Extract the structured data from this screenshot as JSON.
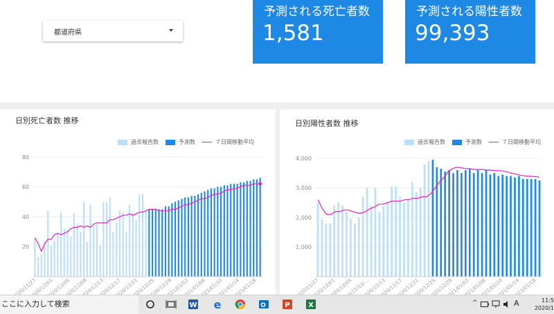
{
  "filter": {
    "label": "都道府県"
  },
  "kpis": [
    {
      "label": "予測される死亡者数",
      "value": "1,581"
    },
    {
      "label": "予測される陽性者数",
      "value": "99,393"
    }
  ],
  "colors": {
    "past": "#bbdefb",
    "forecast": "#1e88e5",
    "avg": "#e91ec7",
    "kpi_bg": "#1e88e5"
  },
  "legend": {
    "past": "過去報告数",
    "forecast": "予測数",
    "avg": "７日間移動平均"
  },
  "chart_data": [
    {
      "type": "bar",
      "title": "日別死亡者数 推移",
      "series_names": [
        "過去報告数",
        "予測数",
        "７日間移動平均"
      ],
      "ylim": [
        0,
        85
      ],
      "yticks": [
        20,
        40,
        60,
        80
      ],
      "ytick_labels": [
        "20",
        "40",
        "60",
        "80"
      ],
      "x_labels": [
        "2020/11/27",
        "2020/12/01",
        "2020/12/05",
        "2020/12/09",
        "2020/12/13",
        "2020/12/17",
        "2020/12/21",
        "2020/12/25",
        "2020/12/29",
        "2021/01/02",
        "2021/01/06",
        "2021/01/10",
        "2021/01/14",
        "2021/01/18"
      ],
      "past": [
        26,
        13,
        15,
        24,
        44,
        21,
        24,
        29,
        43,
        32,
        31,
        27,
        42,
        35,
        30,
        50,
        23,
        48,
        33,
        35,
        21,
        50,
        50,
        53,
        30,
        36,
        44,
        43,
        30,
        48,
        43,
        38,
        55,
        55,
        44
      ],
      "forecast": [
        45,
        45,
        45,
        45,
        45,
        47,
        47,
        49,
        50,
        51,
        52,
        53,
        53,
        54,
        54,
        55,
        56,
        57,
        58,
        59,
        59,
        60,
        60,
        61,
        61,
        62,
        62,
        62,
        63,
        63,
        64,
        64,
        65,
        65,
        66
      ],
      "avg": [
        26,
        22,
        17,
        22,
        25,
        25,
        28,
        29,
        28,
        29,
        30,
        32,
        33,
        33,
        34,
        33,
        34,
        33,
        35,
        36,
        36,
        36,
        36,
        38,
        38,
        39,
        40,
        41,
        41,
        42,
        41,
        42,
        43,
        43,
        44,
        45,
        45,
        45,
        44,
        44,
        44,
        44,
        45,
        45,
        46,
        47,
        48,
        48,
        49,
        50,
        51,
        52,
        52,
        53,
        54,
        55,
        55,
        56,
        57,
        58,
        58,
        59,
        59,
        60,
        61,
        61,
        61,
        62,
        62,
        62
      ]
    },
    {
      "type": "bar",
      "title": "日別陽性者数 推移",
      "series_names": [
        "過去報告数",
        "予測数",
        "７日間移動平均"
      ],
      "ylim": [
        0,
        4300
      ],
      "yticks": [
        1000,
        2000,
        3000,
        4000
      ],
      "ytick_labels": [
        "1,000",
        "2,000",
        "3,000",
        "4,000"
      ],
      "x_labels": [
        "2020/11/27",
        "2020/12/01",
        "2020/12/05",
        "2020/12/12/...",
        "2020/12/13",
        "2020/12/17",
        "2020/12/21",
        "2020/12/25",
        "2020/12/29",
        "2021/01/02",
        "2021/01/06",
        "2021/01/10",
        "2021/01/14",
        "2021/01/18"
      ],
      "past": [
        2500,
        1950,
        1800,
        1800,
        2400,
        2500,
        2400,
        2200,
        1950,
        1800,
        2000,
        2700,
        3000,
        2400,
        3000,
        2200,
        2400,
        2500,
        3050,
        3050,
        2700,
        2500,
        2600,
        3200,
        2850,
        3000,
        3800,
        3900
      ],
      "forecast": [
        3950,
        3700,
        3650,
        3550,
        3600,
        3500,
        3600,
        3500,
        3600,
        3650,
        3500,
        3600,
        3500,
        3600,
        3450,
        3500,
        3400,
        3450,
        3400,
        3400,
        3350,
        3400,
        3300,
        3300,
        3300,
        3300,
        3250
      ],
      "avg": [
        2600,
        2300,
        2100,
        2100,
        2200,
        2200,
        2250,
        2250,
        2200,
        2150,
        2150,
        2200,
        2300,
        2350,
        2450,
        2450,
        2500,
        2550,
        2550,
        2550,
        2600,
        2600,
        2650,
        2650,
        2700,
        2700,
        2800,
        3000,
        3200,
        3350,
        3550,
        3650,
        3700,
        3680,
        3650,
        3650,
        3620,
        3620,
        3620,
        3600,
        3600,
        3580,
        3580,
        3560,
        3520,
        3480,
        3450,
        3420,
        3400,
        3390,
        3380,
        3360
      ]
    }
  ],
  "taskbar": {
    "search_text": "ここに入力して検索",
    "icons": [
      "cortana-icon",
      "task-view-icon",
      "word-icon",
      "edge-icon",
      "chrome-icon",
      "outlook-icon",
      "powerpoint-icon",
      "excel-icon"
    ],
    "ime": "A",
    "time": "11:5",
    "date": "2020/1"
  }
}
